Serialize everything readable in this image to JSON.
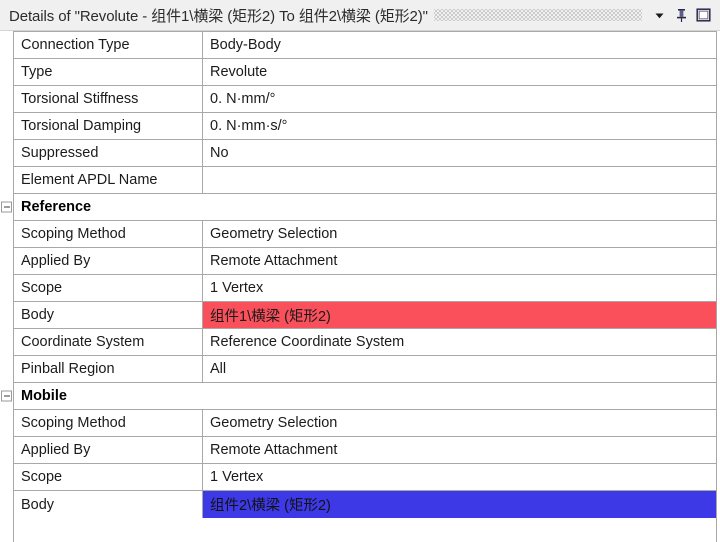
{
  "titlebar": {
    "title": "Details of \"Revolute - 组件1\\横梁 (矩形2) To 组件2\\横梁 (矩形2)\"",
    "grip_icon": "dotted-grip-icon",
    "dropdown_icon": "chevron-down-icon",
    "pin_icon": "pin-icon",
    "window_icon": "window-restore-icon"
  },
  "colors": {
    "highlight_red": "#f9505c",
    "highlight_blue": "#3d39e6",
    "titlebar_bg": "#f0f0f0",
    "grid_line": "#a8a8a8"
  },
  "grid": {
    "rows": [
      {
        "type": "data",
        "label": "Connection Type",
        "value": "Body-Body",
        "highlight": "none"
      },
      {
        "type": "data",
        "label": "Type",
        "value": "Revolute",
        "highlight": "none"
      },
      {
        "type": "data",
        "label": "Torsional Stiffness",
        "value": "0. N·mm/°",
        "highlight": "none"
      },
      {
        "type": "data",
        "label": "Torsional Damping",
        "value": "0. N·mm·s/°",
        "highlight": "none"
      },
      {
        "type": "data",
        "label": "Suppressed",
        "value": "No",
        "highlight": "none"
      },
      {
        "type": "data",
        "label": "Element APDL Name",
        "value": "",
        "highlight": "none"
      },
      {
        "type": "section",
        "label": "Reference",
        "value": "",
        "highlight": "none",
        "expanded": true
      },
      {
        "type": "data",
        "label": "Scoping Method",
        "value": "Geometry Selection",
        "highlight": "none"
      },
      {
        "type": "data",
        "label": "Applied By",
        "value": "Remote Attachment",
        "highlight": "none"
      },
      {
        "type": "data",
        "label": "Scope",
        "value": "1 Vertex",
        "highlight": "none"
      },
      {
        "type": "data",
        "label": "Body",
        "value": "组件1\\横梁 (矩形2)",
        "highlight": "red"
      },
      {
        "type": "data",
        "label": "Coordinate System",
        "value": "Reference Coordinate System",
        "highlight": "none"
      },
      {
        "type": "data",
        "label": "Pinball Region",
        "value": "All",
        "highlight": "none"
      },
      {
        "type": "section",
        "label": "Mobile",
        "value": "",
        "highlight": "none",
        "expanded": true
      },
      {
        "type": "data",
        "label": "Scoping Method",
        "value": "Geometry Selection",
        "highlight": "none"
      },
      {
        "type": "data",
        "label": "Applied By",
        "value": "Remote Attachment",
        "highlight": "none"
      },
      {
        "type": "data",
        "label": "Scope",
        "value": "1 Vertex",
        "highlight": "none"
      },
      {
        "type": "data",
        "label": "Body",
        "value": "组件2\\横梁 (矩形2)",
        "highlight": "blue"
      }
    ]
  }
}
